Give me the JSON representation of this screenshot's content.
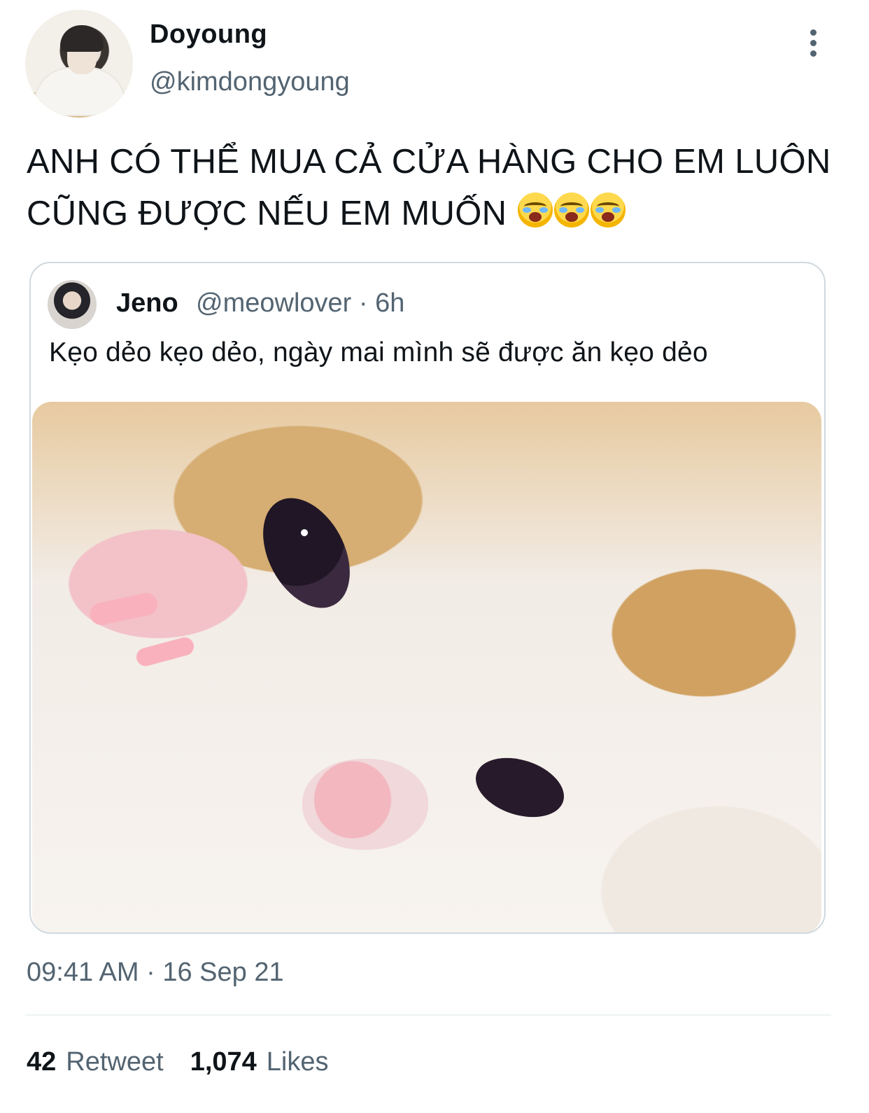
{
  "tweet": {
    "author": {
      "name": "Doyoung",
      "handle": "@kimdongyoung"
    },
    "text": "ANH CÓ THỂ MUA CẢ CỬA HÀNG CHO EM LUÔN CŨNG ĐƯỢC NẾU EM MUỐN",
    "emojis": [
      "loudly-crying-face-emoji",
      "loudly-crying-face-emoji",
      "loudly-crying-face-emoji"
    ],
    "quoted": {
      "author": {
        "name": "Jeno",
        "handle": "@meowlover",
        "time": "6h"
      },
      "meta": "@meowlover · 6h",
      "text": "Kẹo dẻo kẹo dẻo, ngày mai mình sẽ được ăn kẹo dẻo"
    },
    "timestamp": "09:41 AM · 16 Sep 21",
    "stats": {
      "retweets": "42",
      "retweets_label": "Retweet",
      "likes": "1,074",
      "likes_label": "Likes"
    }
  }
}
